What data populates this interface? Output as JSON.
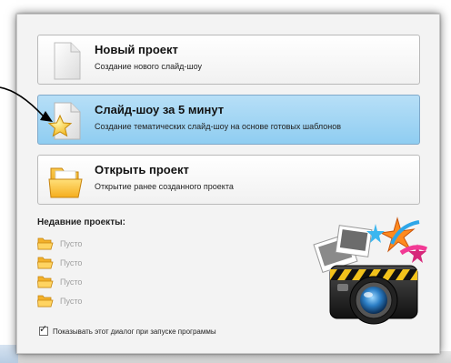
{
  "cards": [
    {
      "title": "Новый проект",
      "subtitle": "Создание нового слайд-шоу",
      "icon": "blank-document-icon",
      "selected": false
    },
    {
      "title": "Слайд-шоу за 5 минут",
      "subtitle": "Создание тематических слайд-шоу на основе готовых шаблонов",
      "icon": "star-document-icon",
      "selected": true
    },
    {
      "title": "Открыть проект",
      "subtitle": "Открытие ранее созданного проекта",
      "icon": "folder-icon",
      "selected": false
    }
  ],
  "recent": {
    "title": "Недавние проекты:",
    "items": [
      "Пусто",
      "Пусто",
      "Пусто",
      "Пусто"
    ]
  },
  "startup_checkbox": {
    "label": "Показывать этот диалог при запуске программы",
    "checked": true
  },
  "colors": {
    "selected_card": "#8fcdf1",
    "folder": "#f5b82a",
    "dialog_bg": "#f3f3f3"
  }
}
